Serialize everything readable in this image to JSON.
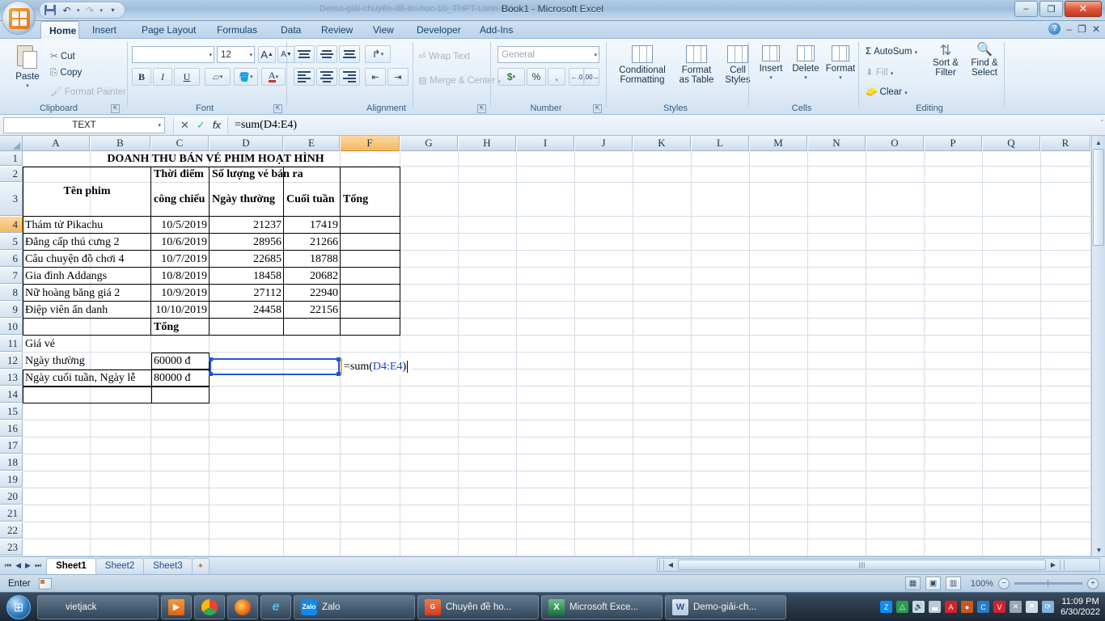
{
  "window": {
    "title": "Book1 - Microsoft Excel",
    "ghost_title": "Demo-giải-chuyên-đề-tin-học-10_THPT-Lanh-Điệu - Microsoft W...",
    "minimize": "–",
    "restore": "❐",
    "close": "✕"
  },
  "quick_access": {
    "save": "save-icon",
    "undo": "↶",
    "redo": "↷",
    "customize": "▾"
  },
  "doc_controls": {
    "help": "?",
    "minimize": "–",
    "restore": "❐",
    "close": "✕"
  },
  "ribbon": {
    "tabs": [
      {
        "label": "Home",
        "active": true
      },
      {
        "label": "Insert",
        "active": false
      },
      {
        "label": "Page Layout",
        "active": false
      },
      {
        "label": "Formulas",
        "active": false
      },
      {
        "label": "Data",
        "active": false
      },
      {
        "label": "Review",
        "active": false
      },
      {
        "label": "View",
        "active": false
      },
      {
        "label": "Developer",
        "active": false
      },
      {
        "label": "Add-Ins",
        "active": false
      }
    ],
    "clipboard": {
      "group_label": "Clipboard",
      "paste": "Paste",
      "cut": "Cut",
      "copy": "Copy",
      "format_painter": "Format Painter"
    },
    "font": {
      "group_label": "Font",
      "font_name_value": "",
      "font_name_placeholder": "",
      "font_size_value": "12",
      "grow_font": "A",
      "shrink_font": "A",
      "bold": "B",
      "italic": "I",
      "underline": "U",
      "borders": "▦",
      "fill_color": "A",
      "font_color": "A"
    },
    "alignment": {
      "group_label": "Alignment",
      "wrap_text": "Wrap Text",
      "merge_center": "Merge & Center",
      "orientation": "↱"
    },
    "number": {
      "group_label": "Number",
      "format_value": "General",
      "currency": "$",
      "percent": "%",
      "comma": ",",
      "increase_decimal": ".00",
      "decrease_decimal": ".00"
    },
    "styles": {
      "group_label": "Styles",
      "conditional_formatting": "Conditional\nFormatting",
      "conditional_formatting_l1": "Conditional",
      "conditional_formatting_l2": "Formatting",
      "format_as_table_l1": "Format",
      "format_as_table_l2": "as Table",
      "cell_styles_l1": "Cell",
      "cell_styles_l2": "Styles"
    },
    "cells": {
      "group_label": "Cells",
      "insert": "Insert",
      "delete": "Delete",
      "format": "Format"
    },
    "editing": {
      "group_label": "Editing",
      "autosum": "AutoSum",
      "fill": "Fill",
      "clear": "Clear",
      "sort_filter_l1": "Sort &",
      "sort_filter_l2": "Filter",
      "find_select_l1": "Find &",
      "find_select_l2": "Select"
    }
  },
  "formula_bar": {
    "name_box": "TEXT",
    "cancel": "✕",
    "enter": "✓",
    "insert_function": "fx",
    "formula_prefix": "=sum(",
    "formula_ref": "D4:E4",
    "formula_suffix": ")",
    "expand": "ˇ"
  },
  "grid": {
    "columns": [
      "A",
      "B",
      "C",
      "D",
      "E",
      "F",
      "G",
      "H",
      "I",
      "J",
      "K",
      "L",
      "M",
      "N",
      "O",
      "P",
      "Q",
      "R"
    ],
    "selected_column": "F",
    "rows": [
      "1",
      "2",
      "3",
      "4",
      "5",
      "6",
      "7",
      "8",
      "9",
      "10",
      "11",
      "12",
      "13",
      "14",
      "15",
      "16",
      "17",
      "18",
      "19",
      "20",
      "21",
      "22",
      "23"
    ],
    "selected_row": "4",
    "title": "DOANH THU BÁN VÉ PHIM HOẠT HÌNH",
    "header": {
      "ten_phim": "Tên phim",
      "thoi_diem": "Thời điểm",
      "cong_chieu": "công chiếu",
      "so_luong": "Số lượng vé bán ra",
      "ngay_thuong": "Ngày thường",
      "cuoi_tuan": "Cuối tuần",
      "tong": "Tổng"
    },
    "data_rows": [
      {
        "name": "Thám tử Pikachu",
        "date": "10/5/2019",
        "weekday": "21237",
        "weekend": "17419",
        "total": ""
      },
      {
        "name": "Đẳng cấp thú cưng 2",
        "date": "10/6/2019",
        "weekday": "28956",
        "weekend": "21266",
        "total": ""
      },
      {
        "name": "Câu chuyện đồ chơi 4",
        "date": "10/7/2019",
        "weekday": "22685",
        "weekend": "18788",
        "total": ""
      },
      {
        "name": "Gia đình Addangs",
        "date": "10/8/2019",
        "weekday": "18458",
        "weekend": "20682",
        "total": ""
      },
      {
        "name": "Nữ hoàng băng giá 2",
        "date": "10/9/2019",
        "weekday": "27112",
        "weekend": "22940",
        "total": ""
      },
      {
        "name": "Điệp viên ẩn danh",
        "date": "10/10/2019",
        "weekday": "24458",
        "weekend": "22156",
        "total": ""
      }
    ],
    "tong_label": "Tổng",
    "gia_ve_label": "Giá vé",
    "price_rows": [
      {
        "label": "Ngày thường",
        "value": "60000 đ"
      },
      {
        "label": "Ngày cuối tuần, Ngày lễ",
        "value": "80000 đ"
      }
    ],
    "editing_cell": {
      "ref": "F4",
      "prefix": "=sum(",
      "range": "D4:E4",
      "suffix": ")"
    }
  },
  "sheet_tabs": {
    "first": "⏮",
    "prev": "◀",
    "next": "▶",
    "last": "⏭",
    "tabs": [
      {
        "label": "Sheet1",
        "active": true
      },
      {
        "label": "Sheet2",
        "active": false
      },
      {
        "label": "Sheet3",
        "active": false
      }
    ],
    "new_sheet": "➕"
  },
  "status_bar": {
    "mode": "Enter",
    "zoom": "100%",
    "zoom_out": "−",
    "zoom_in": "+",
    "views": [
      "normal-view",
      "page-layout-view",
      "page-break-view"
    ]
  },
  "taskbar": {
    "start": "⊞",
    "items": [
      {
        "label": "vietjack",
        "icon": "folder-icon",
        "color": "#f0c060"
      },
      {
        "label": "",
        "icon": "media-player-icon",
        "color": "#e87722"
      },
      {
        "label": "",
        "icon": "chrome-icon",
        "color": "#2a8a42"
      },
      {
        "label": "",
        "icon": "firefox-icon",
        "color": "#e85d14"
      },
      {
        "label": "",
        "icon": "internet-explorer-icon",
        "color": "#1a7fc1"
      },
      {
        "label": "Zalo",
        "icon": "zalo-icon",
        "color": "#0d8bf0"
      },
      {
        "label": "Chuyên đề ho...",
        "icon": "pdf-icon",
        "color": "#e2563c"
      },
      {
        "label": "Microsoft Exce...",
        "icon": "excel-icon",
        "color": "#1d7044"
      },
      {
        "label": "Demo-giải-ch...",
        "icon": "word-icon",
        "color": "#2a5699"
      }
    ],
    "tray": [
      {
        "name": "zalo-tray-icon",
        "glyph": "Z",
        "color": "#0d8bf0"
      },
      {
        "name": "google-drive-tray-icon",
        "glyph": "△",
        "color": "#2a9d4e"
      },
      {
        "name": "volume-tray-icon",
        "glyph": "🔊",
        "color": "#c9dbe9"
      },
      {
        "name": "network-tray-icon",
        "glyph": "▃",
        "color": "#b9cbd9"
      },
      {
        "name": "avira-tray-icon",
        "glyph": "A",
        "color": "#d2232a"
      },
      {
        "name": "unikey-tray-icon",
        "glyph": "●",
        "color": "#c9571e"
      },
      {
        "name": "coccoc-tray-icon",
        "glyph": "C",
        "color": "#2a7ac4"
      },
      {
        "name": "vcam-tray-icon",
        "glyph": "V",
        "color": "#cf2431"
      },
      {
        "name": "bluetooth-tray-icon",
        "glyph": "✕",
        "color": "#9aa8b4"
      },
      {
        "name": "action-center-icon",
        "glyph": "⚑",
        "color": "#cfdbe6"
      },
      {
        "name": "sync-tray-icon",
        "glyph": "⟳",
        "color": "#7fb4e0"
      }
    ],
    "clock_time": "11:09 PM",
    "clock_date": "6/30/2022"
  }
}
